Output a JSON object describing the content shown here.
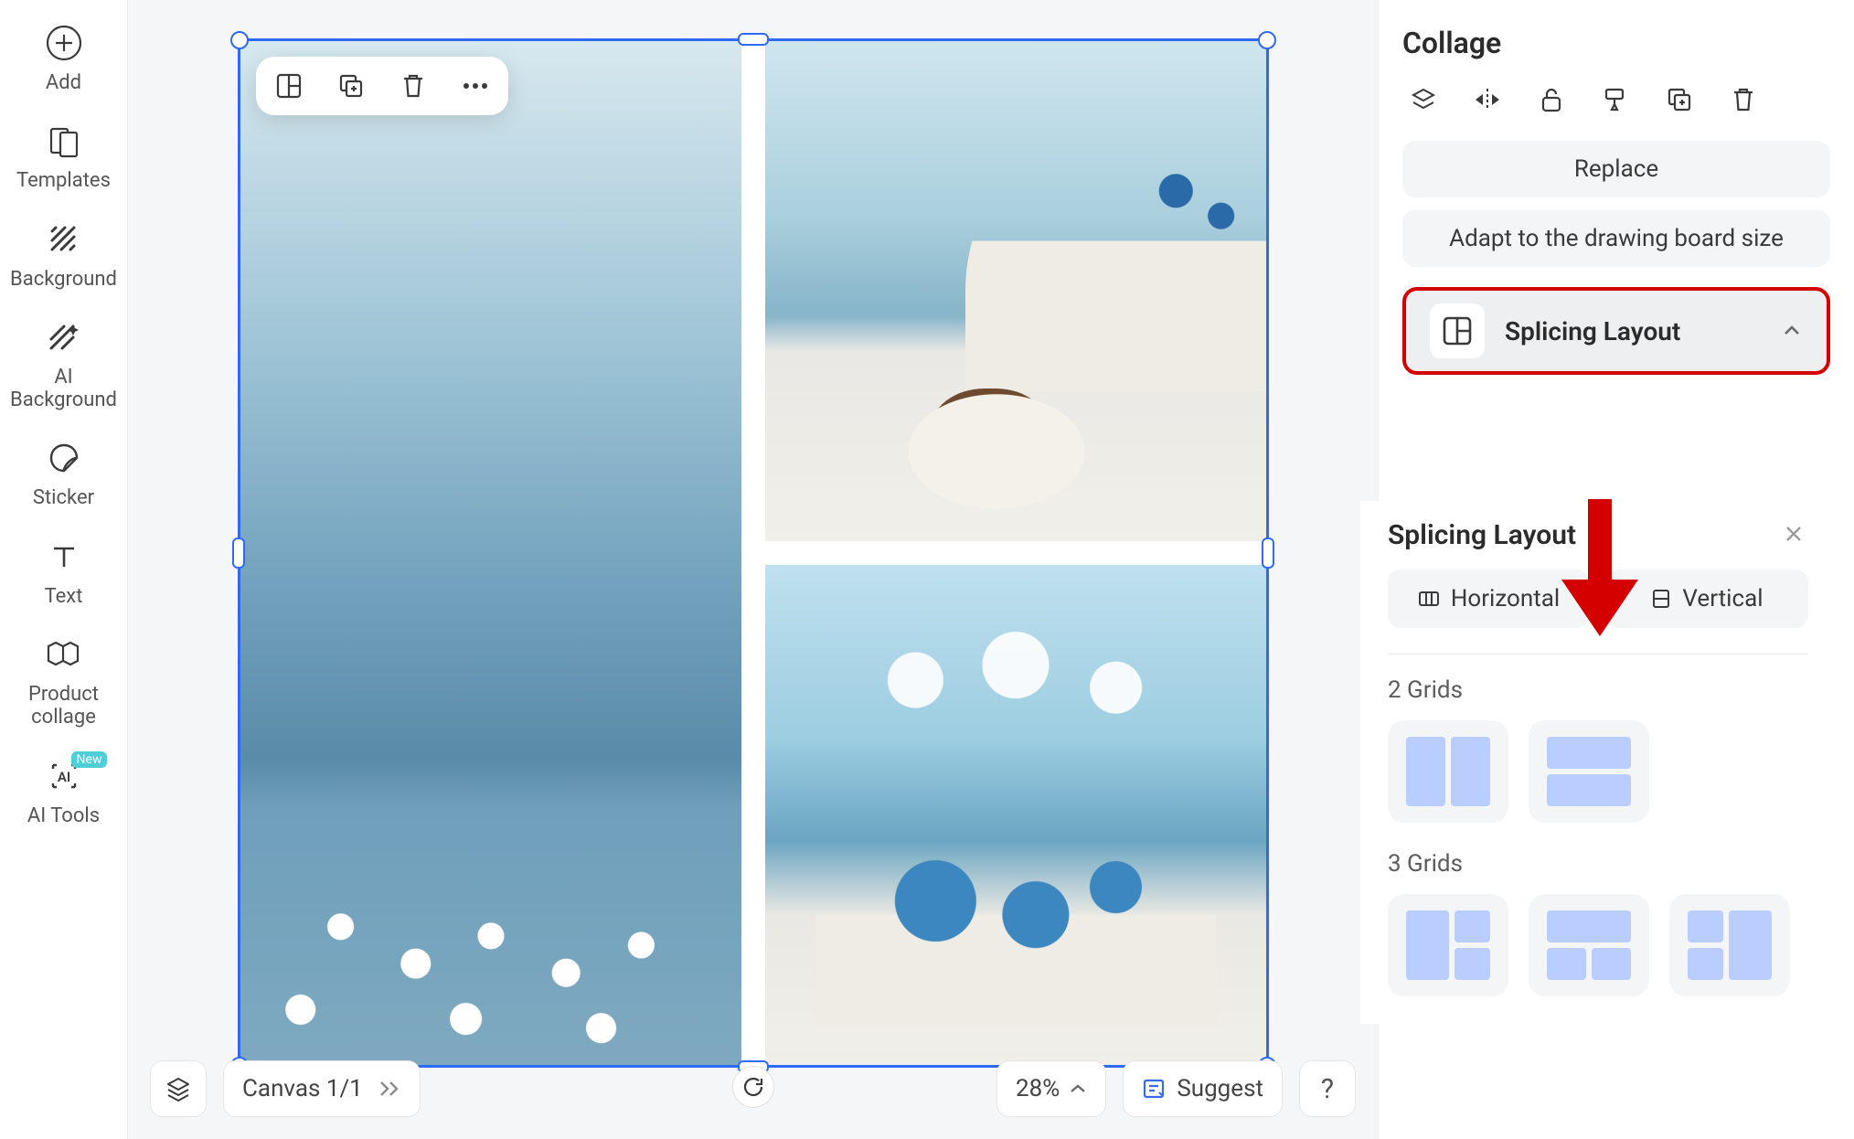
{
  "sidebar": {
    "items": [
      {
        "label": "Add"
      },
      {
        "label": "Templates"
      },
      {
        "label": "Background"
      },
      {
        "label": "AI Background"
      },
      {
        "label": "Sticker"
      },
      {
        "label": "Text"
      },
      {
        "label": "Product collage"
      },
      {
        "label": "AI Tools",
        "badge": "New"
      }
    ]
  },
  "canvas": {
    "label": "Canvas 1/1",
    "zoom": "28%",
    "suggest": "Suggest",
    "help": "?"
  },
  "right": {
    "title": "Collage",
    "replace": "Replace",
    "adapt": "Adapt to the drawing board size",
    "splicing": "Splicing Layout"
  },
  "pop": {
    "title": "Splicing Layout",
    "horizontal": "Horizontal",
    "vertical": "Vertical",
    "group2": "2 Grids",
    "group3": "3 Grids"
  }
}
